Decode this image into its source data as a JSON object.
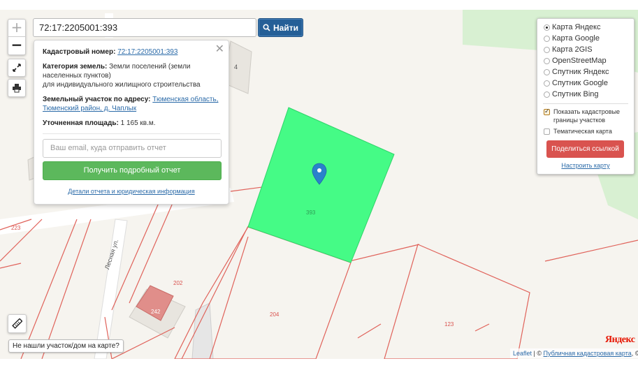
{
  "search": {
    "value": "72:17:2205001:393",
    "button_label": "Найти"
  },
  "popup": {
    "cadastral_label": "Кадастровый номер:",
    "cadastral_value": "72:17:2205001:393",
    "category_label": "Категория земель:",
    "category_value_1": "Земли поселений (земли населенных пунктов)",
    "category_value_2": "для индивидуального жилищного строительства",
    "address_label": "Земельный участок по адресу:",
    "address_value": "Тюменская область, Тюменский район, д. Чаплык",
    "area_label": "Уточненная площадь:",
    "area_value": "1 165 кв.м.",
    "email_placeholder": "Ваш email, куда отправить отчет",
    "report_button": "Получить подробный отчет",
    "details_link": "Детали отчета и юридическая информация"
  },
  "layers": {
    "base_maps": [
      {
        "label": "Карта Яндекс",
        "selected": true
      },
      {
        "label": "Карта Google",
        "selected": false
      },
      {
        "label": "Карта 2GIS",
        "selected": false
      },
      {
        "label": "OpenStreetMap",
        "selected": false
      },
      {
        "label": "Спутник Яндекс",
        "selected": false
      },
      {
        "label": "Спутник Google",
        "selected": false
      },
      {
        "label": "Спутник Bing",
        "selected": false
      }
    ],
    "show_cadastral": {
      "label": "Показать кадастровые границы участков",
      "checked": true
    },
    "thematic": {
      "label": "Тематическая карта",
      "checked": false
    },
    "share_button": "Поделиться ссылкой",
    "setup_link": "Настроить карту"
  },
  "map": {
    "plot_labels": {
      "plot_393": "393",
      "plot_223": "223",
      "plot_202": "202",
      "plot_204": "204",
      "plot_123": "123"
    },
    "house_numbers": {
      "house_4": "4",
      "house_242": "242"
    },
    "street": "Лесная ул.",
    "selected_fill": "#45fb86",
    "boundary_color": "#e0625a",
    "marker_color": "#2a81cb"
  },
  "footer": {
    "not_found": "Не нашли участок/дом на карте?",
    "yandex_logo": "Яндекс",
    "attrib_leaflet": "Leaflet",
    "attrib_sep": " | © ",
    "attrib_public": "Публичная кадастровая карта",
    "attrib_end": ", ©"
  }
}
